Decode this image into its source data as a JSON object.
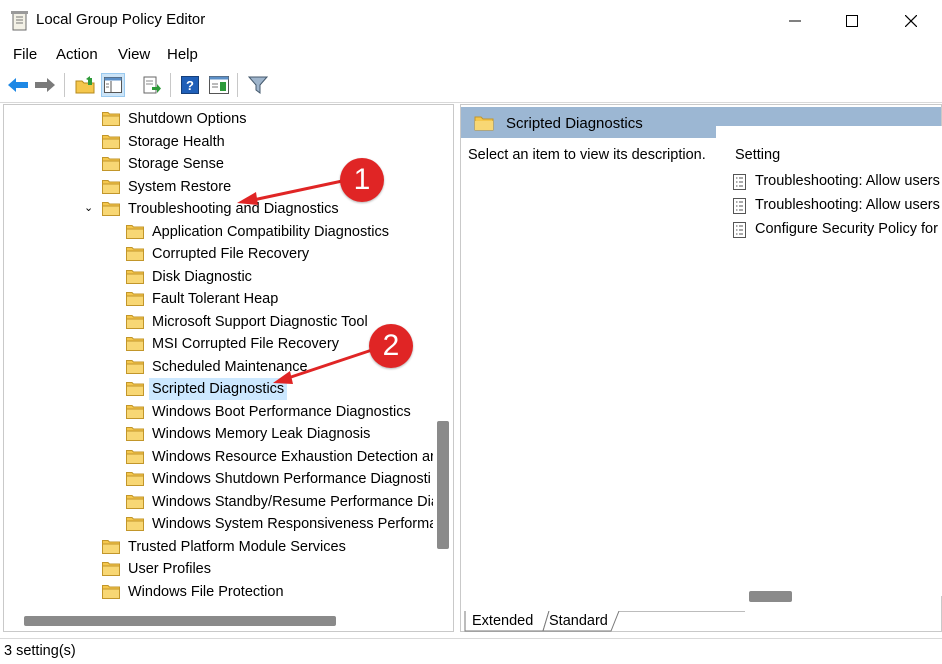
{
  "window": {
    "title": "Local Group Policy Editor",
    "minimize_glyph": "—",
    "maximize_glyph": "☐",
    "close_glyph": "✕"
  },
  "menu": [
    "File",
    "Action",
    "View",
    "Help"
  ],
  "toolbar": {
    "icons": [
      "back-icon",
      "forward-icon",
      "up-folder-icon",
      "show-hide-tree-icon",
      "export-list-icon",
      "help-icon",
      "properties-icon",
      "filter-icon"
    ]
  },
  "tree": {
    "items": [
      {
        "label": "Shutdown Options",
        "level": 1
      },
      {
        "label": "Storage Health",
        "level": 1
      },
      {
        "label": "Storage Sense",
        "level": 1
      },
      {
        "label": "System Restore",
        "level": 1
      },
      {
        "label": "Troubleshooting and Diagnostics",
        "level": 1,
        "expanded": true
      },
      {
        "label": "Application Compatibility Diagnostics",
        "level": 2
      },
      {
        "label": "Corrupted File Recovery",
        "level": 2
      },
      {
        "label": "Disk Diagnostic",
        "level": 2
      },
      {
        "label": "Fault Tolerant Heap",
        "level": 2
      },
      {
        "label": "Microsoft Support Diagnostic Tool",
        "level": 2
      },
      {
        "label": "MSI Corrupted File Recovery",
        "level": 2
      },
      {
        "label": "Scheduled Maintenance",
        "level": 2
      },
      {
        "label": "Scripted Diagnostics",
        "level": 2,
        "selected": true
      },
      {
        "label": "Windows Boot Performance Diagnostics",
        "level": 2
      },
      {
        "label": "Windows Memory Leak Diagnosis",
        "level": 2
      },
      {
        "label": "Windows Resource Exhaustion Detection ar",
        "level": 2
      },
      {
        "label": "Windows Shutdown Performance Diagnosti",
        "level": 2
      },
      {
        "label": "Windows Standby/Resume Performance Dia",
        "level": 2
      },
      {
        "label": "Windows System Responsiveness Performa",
        "level": 2
      },
      {
        "label": "Trusted Platform Module Services",
        "level": 1
      },
      {
        "label": "User Profiles",
        "level": 1
      },
      {
        "label": "Windows File Protection",
        "level": 1
      }
    ],
    "expander_glyph": "⌄"
  },
  "detail": {
    "title": "Scripted Diagnostics",
    "description": "Select an item to view its description.",
    "column_header": "Setting",
    "settings": [
      "Troubleshooting: Allow users",
      "Troubleshooting: Allow users",
      "Configure Security Policy for"
    ]
  },
  "tabs": [
    "Extended",
    "Standard"
  ],
  "status": "3 setting(s)",
  "annotations": [
    "1",
    "2"
  ],
  "colors": {
    "header_bg": "#9cb7d3",
    "selection_bg": "#cce8ff",
    "arrow": "#e02525",
    "folder": "#f5c74c"
  }
}
